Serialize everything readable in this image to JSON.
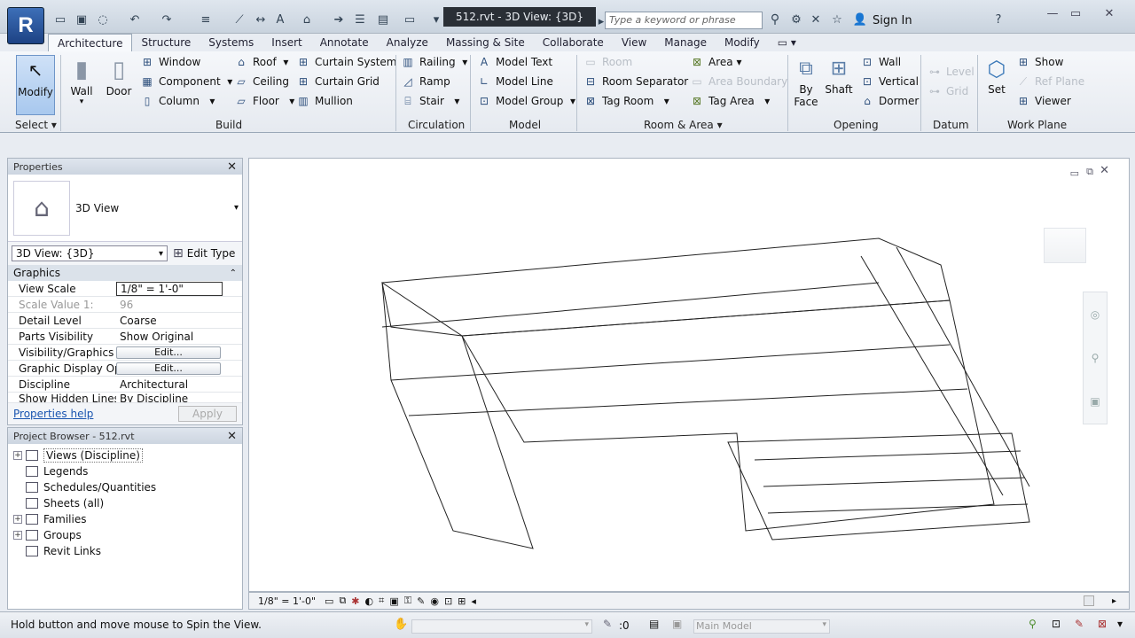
{
  "app": {
    "logo": "R",
    "title": "512.rvt - 3D View: {3D}",
    "search_placeholder": "Type a keyword or phrase",
    "sign_in": "Sign In"
  },
  "tabs": [
    "Architecture",
    "Structure",
    "Systems",
    "Insert",
    "Annotate",
    "Analyze",
    "Massing & Site",
    "Collaborate",
    "View",
    "Manage",
    "Modify"
  ],
  "ribbon": {
    "select": {
      "modify": "Modify",
      "select_label": "Select"
    },
    "build": {
      "title": "Build",
      "wall": "Wall",
      "door": "Door",
      "window": "Window",
      "component": "Component",
      "column": "Column",
      "roof": "Roof",
      "ceiling": "Ceiling",
      "floor": "Floor",
      "curtain_system": "Curtain System",
      "curtain_grid": "Curtain Grid",
      "mullion": "Mullion"
    },
    "circulation": {
      "title": "Circulation",
      "railing": "Railing",
      "ramp": "Ramp",
      "stair": "Stair"
    },
    "model": {
      "title": "Model",
      "model_text": "Model Text",
      "model_line": "Model Line",
      "model_group": "Model Group"
    },
    "room_area": {
      "title": "Room & Area",
      "room": "Room",
      "room_separator": "Room Separator",
      "tag_room": "Tag Room",
      "area": "Area",
      "area_boundary": "Area Boundary",
      "tag_area": "Tag Area"
    },
    "opening": {
      "title": "Opening",
      "by_face_1": "By",
      "by_face_2": "Face",
      "shaft": "Shaft",
      "wall": "Wall",
      "vertical": "Vertical",
      "dormer": "Dormer"
    },
    "datum": {
      "title": "Datum",
      "level": "Level",
      "grid": "Grid"
    },
    "work_plane": {
      "title": "Work Plane",
      "set": "Set",
      "show": "Show",
      "ref_plane": "Ref Plane",
      "viewer": "Viewer"
    }
  },
  "properties": {
    "title": "Properties",
    "type_name": "3D View",
    "instance_selector": "3D View: {3D}",
    "edit_type": "Edit Type",
    "section": "Graphics",
    "rows": [
      {
        "key": "View Scale",
        "value": "1/8\" = 1'-0\""
      },
      {
        "key": "Scale Value    1:",
        "value": "96"
      },
      {
        "key": "Detail Level",
        "value": "Coarse"
      },
      {
        "key": "Parts Visibility",
        "value": "Show Original"
      },
      {
        "key": "Visibility/Graphics ...",
        "value": "Edit..."
      },
      {
        "key": "Graphic Display Op...",
        "value": "Edit..."
      },
      {
        "key": "Discipline",
        "value": "Architectural"
      },
      {
        "key": "Show Hidden Lines",
        "value": "By Discipline"
      }
    ],
    "help": "Properties help",
    "apply": "Apply"
  },
  "browser": {
    "title": "Project Browser - 512.rvt",
    "items": [
      {
        "label": "Views (Discipline)",
        "expander": "+",
        "icon": "views-icon"
      },
      {
        "label": "Legends",
        "expander": "",
        "icon": "legends-icon"
      },
      {
        "label": "Schedules/Quantities",
        "expander": "",
        "icon": "schedules-icon"
      },
      {
        "label": "Sheets (all)",
        "expander": "",
        "icon": "sheets-icon"
      },
      {
        "label": "Families",
        "expander": "+",
        "icon": "families-icon"
      },
      {
        "label": "Groups",
        "expander": "+",
        "icon": "groups-icon"
      },
      {
        "label": "Revit Links",
        "expander": "",
        "icon": "links-icon"
      }
    ]
  },
  "viewport": {
    "scale": "1/8\" = 1'-0\""
  },
  "status": {
    "message": "Hold button and move mouse to Spin the View.",
    "worksets": ":0",
    "model": "Main Model"
  },
  "colors": {
    "accent": "#1d4284",
    "title_bg": "#2a2f36",
    "ribbon_icon": "#2d4f7c"
  }
}
